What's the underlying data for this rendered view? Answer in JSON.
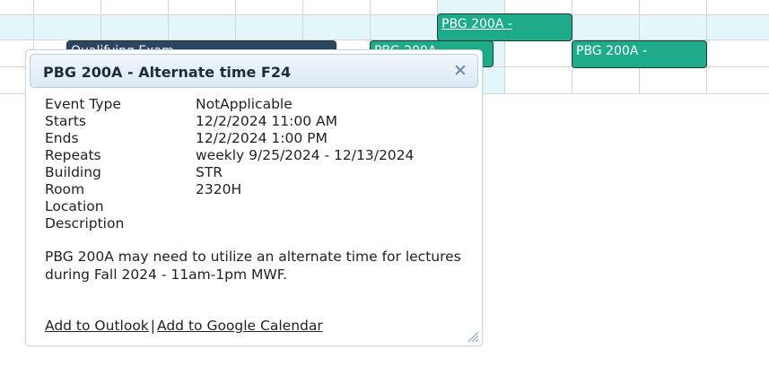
{
  "calendar": {
    "events": [
      {
        "label": "PBG 200A -",
        "style": "teal",
        "link": true
      },
      {
        "label": "Qualifying Exam",
        "style": "navy",
        "link": false
      },
      {
        "label": "PBG 200A -",
        "style": "teal",
        "link": false
      },
      {
        "label": "PBG 200A -",
        "style": "teal",
        "link": false
      }
    ]
  },
  "dialog": {
    "title": "PBG 200A - Alternate time F24",
    "close_symbol": "×",
    "details": [
      {
        "label": "Event Type",
        "value": "NotApplicable"
      },
      {
        "label": "Starts",
        "value": "12/2/2024 11:00 AM"
      },
      {
        "label": "Ends",
        "value": "12/2/2024 1:00 PM"
      },
      {
        "label": "Repeats",
        "value": "weekly 9/25/2024 - 12/13/2024"
      },
      {
        "label": "Building",
        "value": "STR"
      },
      {
        "label": "Room",
        "value": "2320H"
      },
      {
        "label": "Location",
        "value": ""
      },
      {
        "label": "Description",
        "value": ""
      }
    ],
    "description_text": "PBG 200A may need to utilize an alternate time for lectures during Fall 2024 - 11am-1pm MWF.",
    "links": {
      "outlook": "Add to Outlook",
      "separator": "|",
      "google": "Add to Google Calendar"
    }
  },
  "colors": {
    "event_teal": "#1eab8a",
    "event_navy": "#2c4563",
    "row_highlight": "#e3f7fa",
    "close_icon": "#6d8fb0"
  },
  "icons": {
    "close": "close-icon",
    "resize": "resize-handle-icon"
  }
}
